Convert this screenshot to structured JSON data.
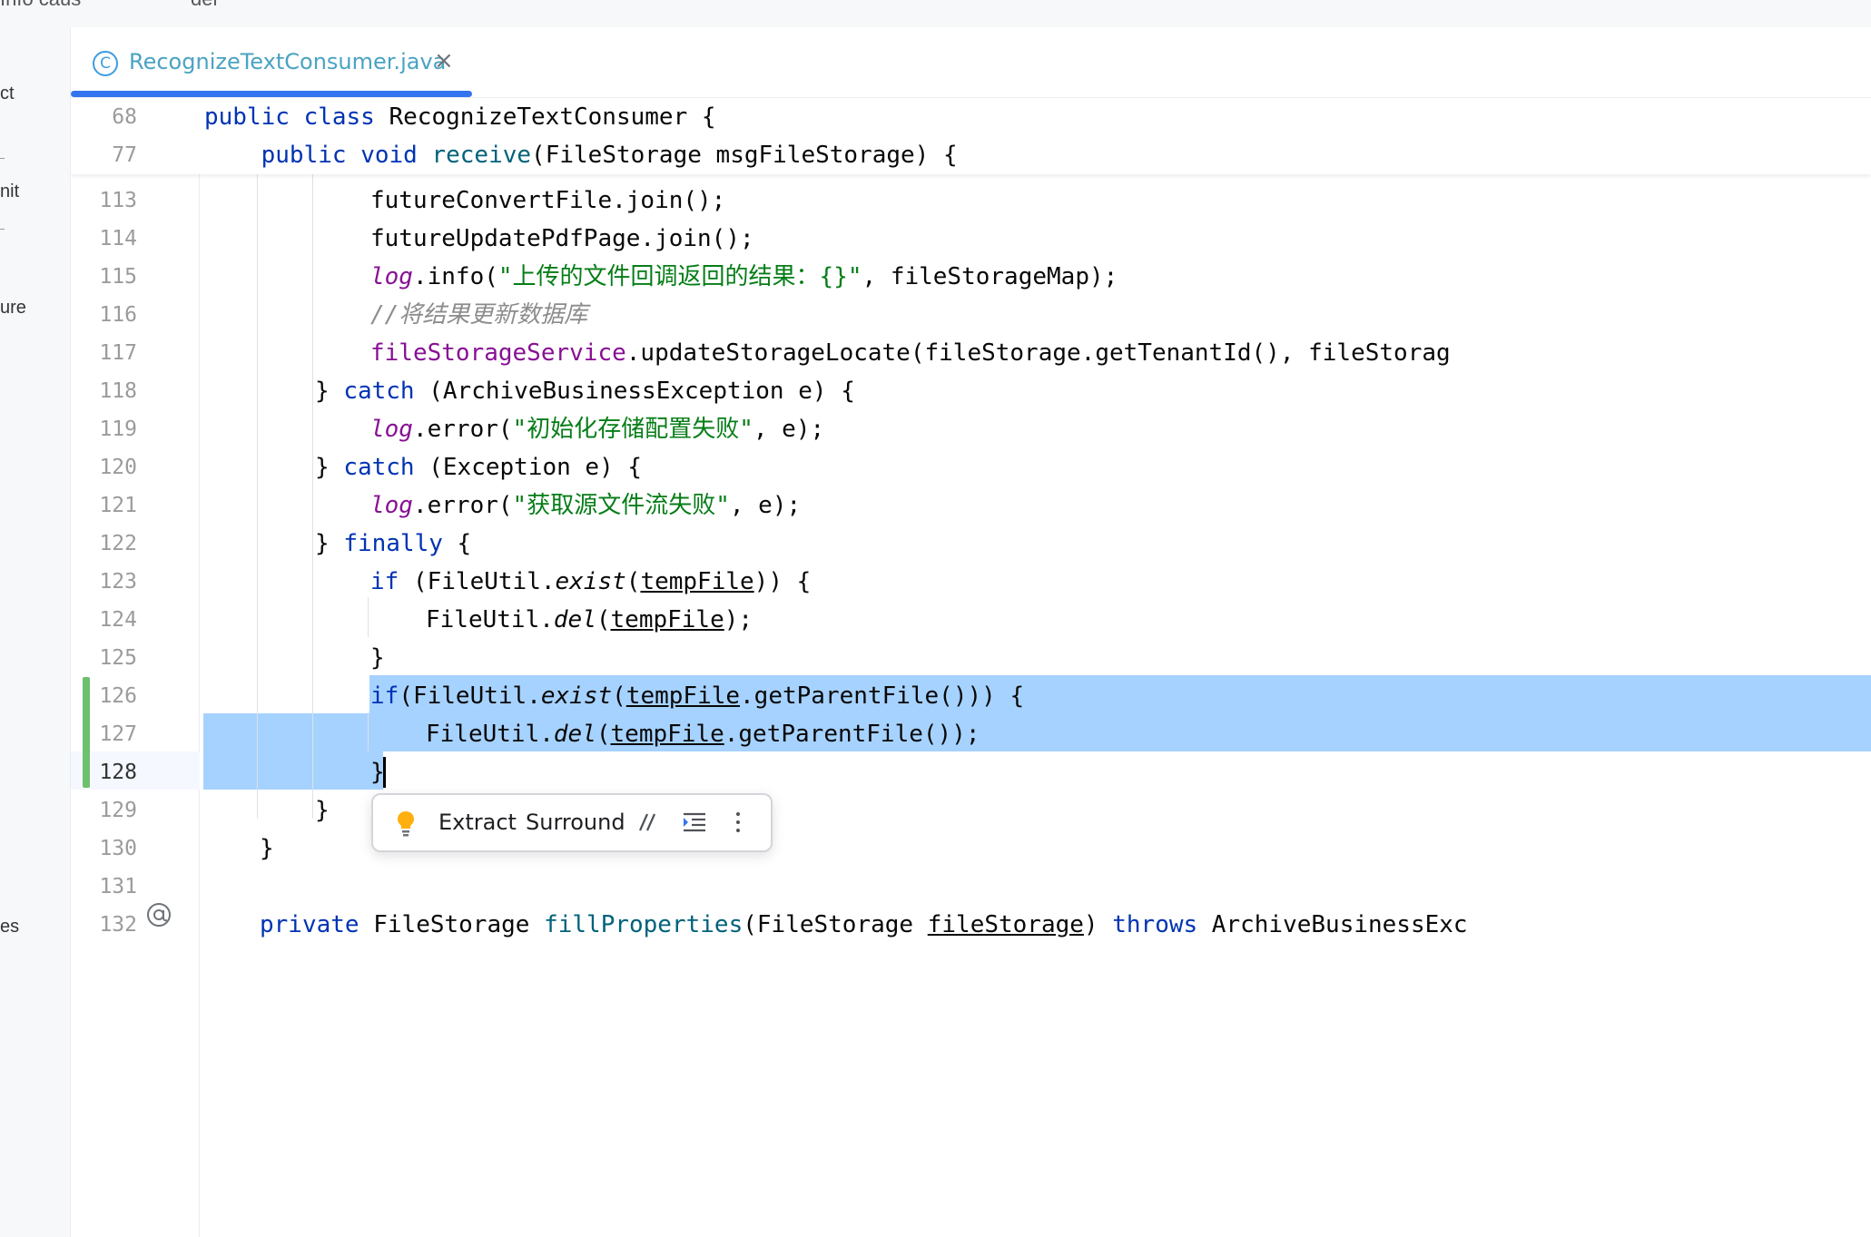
{
  "top_strip": {
    "left_text": "Info caus",
    "right_text": "del"
  },
  "left_panel": {
    "items": [
      "ct",
      "nit",
      "ure",
      "es"
    ]
  },
  "tab": {
    "label": "RecognizeTextConsumer.java",
    "type_icon": "class-icon",
    "close_icon": "close-icon"
  },
  "sticky_lines": [
    {
      "num": "68",
      "text": "public class RecognizeTextConsumer {"
    },
    {
      "num": "77",
      "text": "    public void receive(FileStorage msgFileStorage) {"
    }
  ],
  "lines": [
    {
      "num": "113",
      "text": "futureConvertFile.join();"
    },
    {
      "num": "114",
      "text": "futureUpdatePdfPage.join();"
    },
    {
      "num": "115",
      "text": "log.info(\"上传的文件回调返回的结果：{}\", fileStorageMap);"
    },
    {
      "num": "116",
      "text": "//将结果更新数据库"
    },
    {
      "num": "117",
      "text": "fileStorageService.updateStorageLocate(fileStorage.getTenantId(), fileStorag"
    },
    {
      "num": "118",
      "text": "} catch (ArchiveBusinessException e) {"
    },
    {
      "num": "119",
      "text": "log.error(\"初始化存储配置失败\", e);"
    },
    {
      "num": "120",
      "text": "} catch (Exception e) {"
    },
    {
      "num": "121",
      "text": "log.error(\"获取源文件流失败\", e);"
    },
    {
      "num": "122",
      "text": "} finally {"
    },
    {
      "num": "123",
      "text": "if (FileUtil.exist(tempFile)) {"
    },
    {
      "num": "124",
      "text": "FileUtil.del(tempFile);"
    },
    {
      "num": "125",
      "text": "}"
    },
    {
      "num": "126",
      "text": "if(FileUtil.exist(tempFile.getParentFile())) {"
    },
    {
      "num": "127",
      "text": "FileUtil.del(tempFile.getParentFile());"
    },
    {
      "num": "128",
      "text": "}"
    },
    {
      "num": "129",
      "text": "}"
    },
    {
      "num": "130",
      "text": "}"
    },
    {
      "num": "131",
      "text": ""
    },
    {
      "num": "132",
      "text": "private FileStorage fillProperties(FileStorage fileStorage) throws ArchiveBusinessExc"
    }
  ],
  "current_line": "128",
  "gutter_icon_line_132": "at-icon",
  "popup": {
    "extract_label": "Extract",
    "surround_label": "Surround",
    "icons": [
      "bulb-icon",
      "comment-icon",
      "reformat-icon",
      "more-icon"
    ]
  },
  "colors": {
    "keyword": "#0033b3",
    "string": "#067d17",
    "field": "#871094",
    "comment": "#8c8c8c",
    "method": "#00627a",
    "selection": "#a6d2ff",
    "change_marker": "#6cc06e",
    "tab_underline": "#3574f0"
  }
}
